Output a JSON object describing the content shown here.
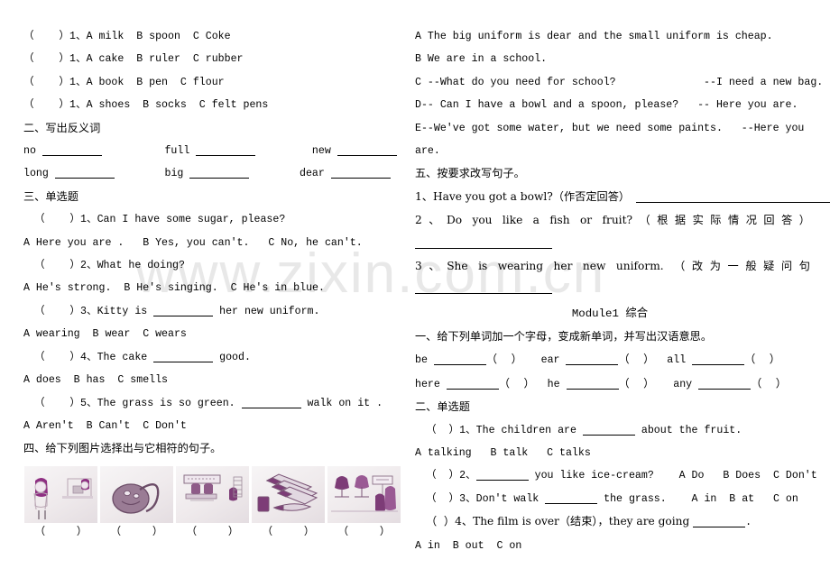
{
  "watermark": {
    "text": "www.zixin.com.cn"
  },
  "left_column": {
    "listening_choices": [
      "（    ）1、A milk  B spoon  C Coke",
      "（    ）1、A cake  B ruler  C rubber",
      "（    ）1、A book  B pen  C flour",
      "（    ）1、A shoes  B socks  C felt pens"
    ],
    "section_two": {
      "heading": "二、写出反义词",
      "pairs_row1": [
        "no",
        "full",
        "new"
      ],
      "pairs_row2": [
        "long",
        "big",
        "dear"
      ]
    },
    "section_three": {
      "heading": "三、单选题",
      "questions": [
        {
          "stem": "（    ）1、Can I have some sugar, please?",
          "options": "A Here you are .   B Yes, you can't.   C No, he can't."
        },
        {
          "stem": "（    ）2、What he doing?",
          "options": "A He's strong.  B He's singing.  C He's in blue."
        },
        {
          "stem_pre": "（    ）3、Kitty is ",
          "stem_post": " her new uniform.",
          "options": "A wearing  B wear  C wears"
        },
        {
          "stem_pre": "（    ）4、The cake ",
          "stem_post": " good.",
          "options": "A does  B has  C smells"
        },
        {
          "stem_pre": "（    ）5、The grass is so green. ",
          "stem_post": " walk on it .",
          "options": "A Aren't  B Can't  C Don't"
        }
      ]
    },
    "section_four": {
      "heading": "四、给下列图片选择出与它相符的句子。",
      "pictures": [
        {
          "name": "shop-counter-scene",
          "answer": "（     ）"
        },
        {
          "name": "handbag",
          "answer": "（     ）"
        },
        {
          "name": "classroom-scene",
          "answer": "（     ）"
        },
        {
          "name": "felt-pens",
          "answer": "（     ）"
        },
        {
          "name": "clothes-shop-scene",
          "answer": "（     ）"
        }
      ]
    }
  },
  "right_column": {
    "match_options": [
      "A The big uniform is dear and the small uniform is cheap.",
      "B We are in a school.",
      "C --What do you need for school?              --I need a new bag.",
      "D-- Can I have a bowl and a spoon, please?   -- Here you are.",
      "E--We've got some water, but we need some paints.   --Here you",
      "are."
    ],
    "section_five": {
      "heading": "五、按要求改写句子。",
      "q1_pre": "1、Have you got a bowl?（作否定回答）",
      "q2": "2、Do you like a fish or fruit?（根据实际情况回答）",
      "q3": "3、She is wearing her new uniform. （改为一般疑问句"
    },
    "module_title_en": "Module1 ",
    "module_title_zh": "综合",
    "module_section_one": {
      "heading": "一、给下列单词加一个字母，变成新单词，并写出汉语意思。",
      "row1": [
        "be",
        "ear",
        "all"
      ],
      "row2": [
        "here",
        "he",
        "any"
      ],
      "paren": "（    ）"
    },
    "module_section_two": {
      "heading": "二、单选题",
      "questions": [
        {
          "stem_pre": "（  ）1、The children are ",
          "stem_post": " about the fruit.",
          "options": "A talking   B talk   C talks"
        },
        {
          "stem_pre": "（  ）2、",
          "stem_post": " you like ice-cream?    A Do   B Does  C Don't",
          "options": ""
        },
        {
          "stem_pre": "（  ）3、Don't walk ",
          "stem_post": " the grass.    A in  B at   C on",
          "options": ""
        },
        {
          "stem_pre": "（  ）4、The film is over（结束），they are going ",
          "stem_post": ".",
          "options": "A in  B out  C on"
        }
      ]
    }
  }
}
